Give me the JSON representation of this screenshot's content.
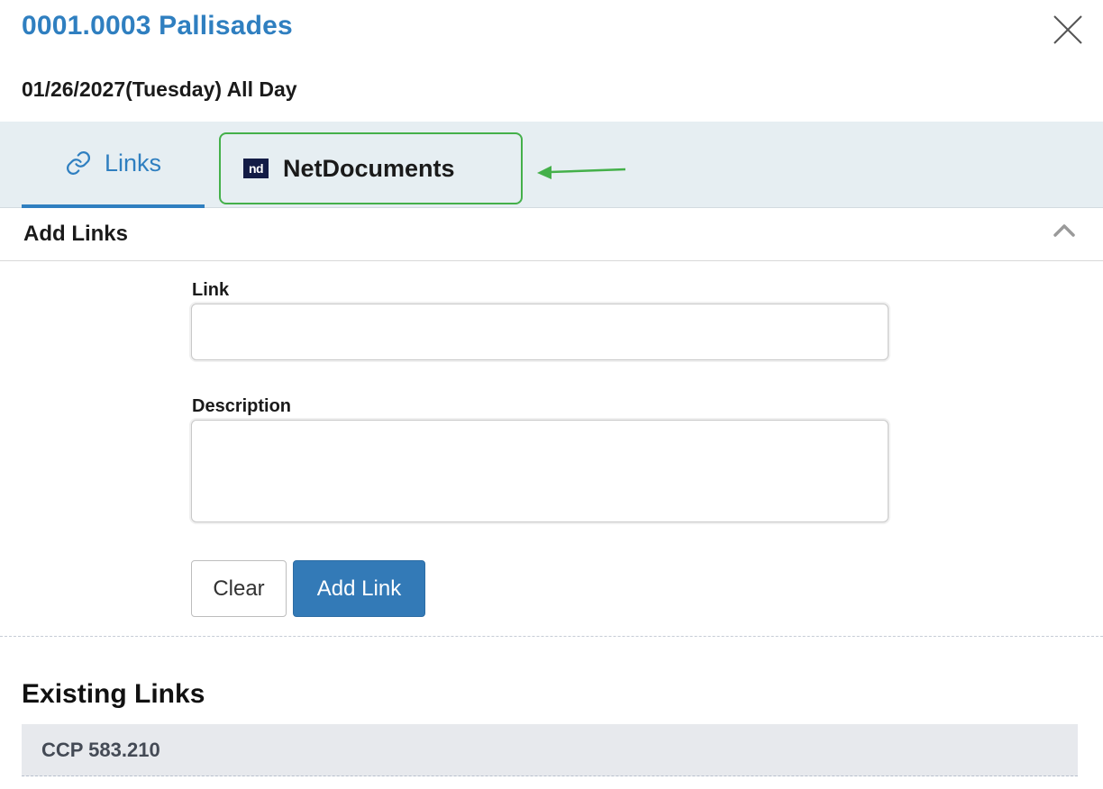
{
  "header": {
    "title": "0001.0003 Pallisades",
    "date_line": "01/26/2027(Tuesday)  All Day"
  },
  "tabs": [
    {
      "label": "Links",
      "icon": "link-icon",
      "active": true
    },
    {
      "label": "NetDocuments",
      "icon": "netdocuments-logo",
      "logo_text": "nd",
      "active": false
    }
  ],
  "section": {
    "title": "Add Links"
  },
  "form": {
    "link_label": "Link",
    "link_value": "",
    "description_label": "Description",
    "description_value": "",
    "clear_label": "Clear",
    "add_label": "Add Link"
  },
  "existing": {
    "title": "Existing Links",
    "items": [
      {
        "label": "CCP 583.210"
      }
    ]
  },
  "colors": {
    "accent": "#2f7fc0",
    "primary_button": "#337ab7",
    "highlight_border": "#44b04a",
    "tab_bar": "#e6eef2"
  }
}
